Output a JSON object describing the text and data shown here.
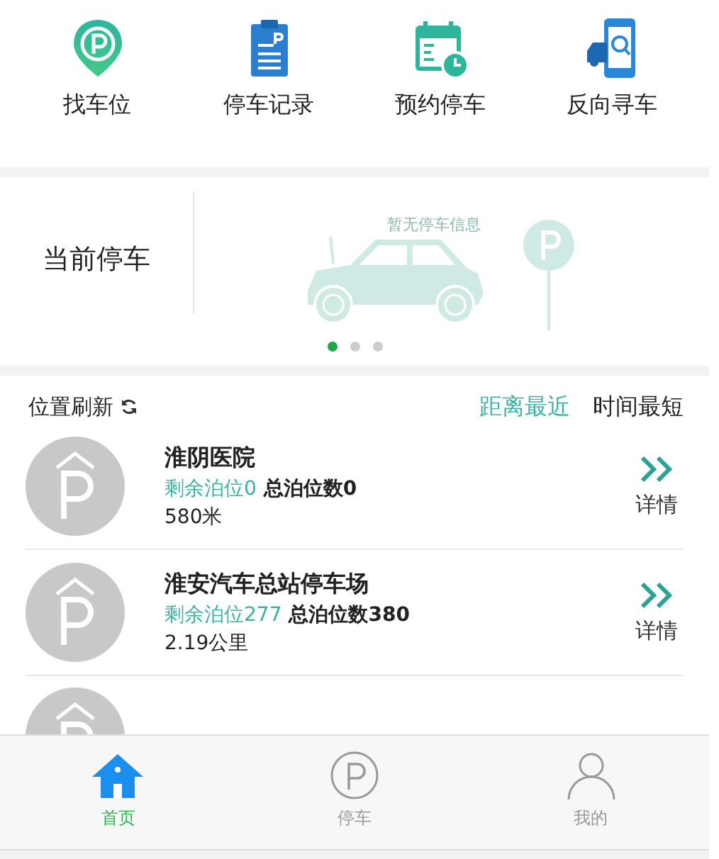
{
  "shortcuts": [
    {
      "kind": "find",
      "label": "找车位"
    },
    {
      "kind": "record",
      "label": "停车记录"
    },
    {
      "kind": "reserve",
      "label": "预约停车"
    },
    {
      "kind": "locate",
      "label": "反向寻车"
    }
  ],
  "current_parking": {
    "title": "当前停车",
    "empty_text": "暂无停车信息",
    "pages": [
      {
        "selected": true
      },
      {
        "selected": false
      },
      {
        "selected": false
      }
    ]
  },
  "list_header": {
    "refresh": "位置刷新",
    "sorts": [
      {
        "label": "距离最近",
        "selected": true
      },
      {
        "label": "时间最短",
        "selected": false
      }
    ]
  },
  "lots": [
    {
      "kind": "full",
      "name": "淮阴医院",
      "free": "剩余泊位0",
      "total": "总泊位数0",
      "distance": "580米",
      "action": "详情"
    },
    {
      "kind": "full",
      "name": "淮安汽车总站停车场",
      "free": "剩余泊位277",
      "total": "总泊位数380",
      "distance": "2.19公里",
      "action": "详情"
    },
    {
      "kind": "partial"
    }
  ],
  "tab_bar": [
    {
      "kind": "home",
      "label": "首页",
      "selected": true
    },
    {
      "kind": "parking",
      "label": "停车",
      "selected": false
    },
    {
      "kind": "profile",
      "label": "我的",
      "selected": false
    }
  ]
}
